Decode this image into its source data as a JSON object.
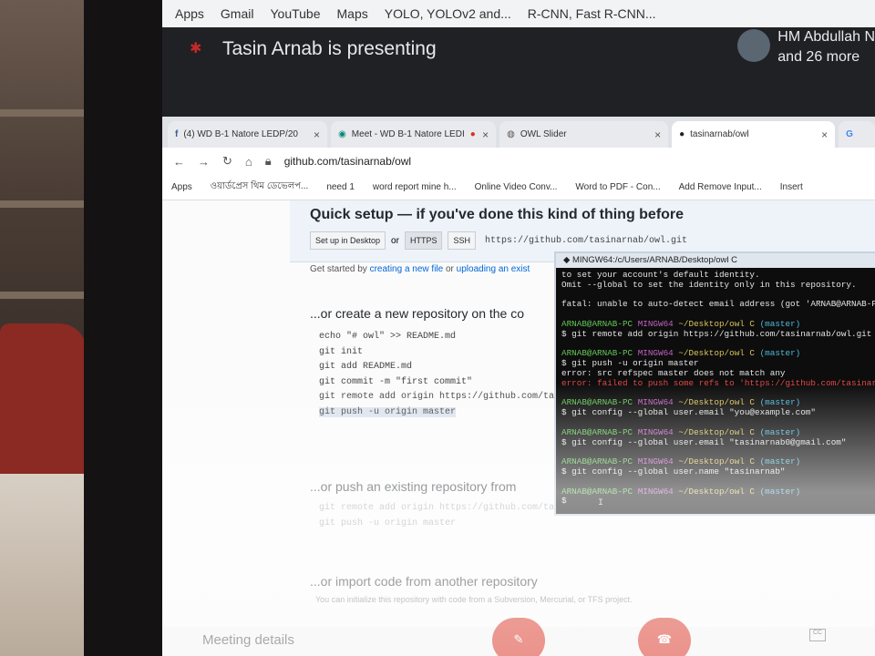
{
  "chrome_top": {
    "bookmarks": [
      "Apps",
      "Gmail",
      "YouTube",
      "Maps",
      "YOLO, YOLOv2 and...",
      "R-CNN, Fast R-CNN..."
    ]
  },
  "meet": {
    "presenter": "Tasin Arnab is presenting",
    "others_line1": "HM Abdullah N",
    "others_line2": "and 26 more",
    "meeting_details": "Meeting details"
  },
  "tabs": [
    {
      "label": "(4) WD B-1 Natore LEDP/20",
      "close": "×"
    },
    {
      "label": "Meet - WD B-1 Natore LEDI",
      "close": "×"
    },
    {
      "label": "OWL Slider",
      "close": "×"
    },
    {
      "label": "tasinarnab/owl",
      "close": "×"
    },
    {
      "label": "G"
    }
  ],
  "omnibox": {
    "url": "github.com/tasinarnab/owl"
  },
  "bookmarks": [
    "Apps",
    "ওয়ার্ডপ্রেস থিম ডেভেলপ...",
    "need 1",
    "word report mine h...",
    "Online Video Conv...",
    "Word to PDF - Con...",
    "Add Remove Input...",
    "Insert"
  ],
  "github": {
    "quick_title": "Quick setup — if you've done this kind of thing before",
    "setup_desktop": "Set up in Desktop",
    "or": "or",
    "https": "HTTPS",
    "ssh": "SSH",
    "clone_url": "https://github.com/tasinarnab/owl.git",
    "hint_start": "Get started by",
    "hint_link1": "creating a new file",
    "hint_mid": "or",
    "hint_link2": "uploading an exist",
    "section_create": "...or create a new repository on the co",
    "create_cmds": [
      "echo \"# owl\" >> README.md",
      "git init",
      "git add README.md",
      "git commit -m \"first commit\"",
      "git remote add origin https://github.com/ta",
      "git push -u origin master"
    ],
    "section_push": "...or push an existing repository from",
    "push_cmds": [
      "git remote add origin https://github.com/ta",
      "git push -u origin master"
    ],
    "section_import": "...or import code from another repository",
    "import_note": "You can initialize this repository with code from a Subversion, Mercurial, or TFS project."
  },
  "terminal": {
    "title": "MINGW64:/c/Users/ARNAB/Desktop/owl C",
    "lines": [
      [
        {
          "t": "to set your account's default identity.",
          "c": ""
        }
      ],
      [
        {
          "t": "Omit --global to set the identity only in this repository.",
          "c": ""
        }
      ],
      [
        {
          "t": " ",
          "c": ""
        }
      ],
      [
        {
          "t": "fatal: unable to auto-detect email address (got 'ARNAB@ARNAB-P",
          "c": ""
        }
      ],
      [
        {
          "t": " ",
          "c": ""
        }
      ],
      [
        {
          "t": "ARNAB@ARNAB-PC ",
          "c": "g"
        },
        {
          "t": "MINGW64 ",
          "c": "m"
        },
        {
          "t": "~/Desktop/owl C ",
          "c": "y"
        },
        {
          "t": "(master)",
          "c": "c"
        }
      ],
      [
        {
          "t": "$ git remote add origin https://github.com/tasinarnab/owl.git",
          "c": ""
        }
      ],
      [
        {
          "t": " ",
          "c": ""
        }
      ],
      [
        {
          "t": "ARNAB@ARNAB-PC ",
          "c": "g"
        },
        {
          "t": "MINGW64 ",
          "c": "m"
        },
        {
          "t": "~/Desktop/owl C ",
          "c": "y"
        },
        {
          "t": "(master)",
          "c": "c"
        }
      ],
      [
        {
          "t": "$ git push -u origin master",
          "c": ""
        }
      ],
      [
        {
          "t": "error: src refspec master does not match any",
          "c": ""
        }
      ],
      [
        {
          "t": "error: failed to push some refs to 'https://github.com/tasinarn",
          "c": "r"
        }
      ],
      [
        {
          "t": " ",
          "c": ""
        }
      ],
      [
        {
          "t": "ARNAB@ARNAB-PC ",
          "c": "g"
        },
        {
          "t": "MINGW64 ",
          "c": "m"
        },
        {
          "t": "~/Desktop/owl C ",
          "c": "y"
        },
        {
          "t": "(master)",
          "c": "c"
        }
      ],
      [
        {
          "t": "$ git config --global user.email \"you@example.com\"",
          "c": ""
        }
      ],
      [
        {
          "t": " ",
          "c": ""
        }
      ],
      [
        {
          "t": "ARNAB@ARNAB-PC ",
          "c": "g"
        },
        {
          "t": "MINGW64 ",
          "c": "m"
        },
        {
          "t": "~/Desktop/owl C ",
          "c": "y"
        },
        {
          "t": "(master)",
          "c": "c"
        }
      ],
      [
        {
          "t": "$ git config --global user.email \"tasinarnab0@gmail.com\"",
          "c": ""
        }
      ],
      [
        {
          "t": " ",
          "c": ""
        }
      ],
      [
        {
          "t": "ARNAB@ARNAB-PC ",
          "c": "g"
        },
        {
          "t": "MINGW64 ",
          "c": "m"
        },
        {
          "t": "~/Desktop/owl C ",
          "c": "y"
        },
        {
          "t": "(master)",
          "c": "c"
        }
      ],
      [
        {
          "t": "$ git config --global user.name \"tasinarnab\"",
          "c": ""
        }
      ],
      [
        {
          "t": " ",
          "c": ""
        }
      ],
      [
        {
          "t": "ARNAB@ARNAB-PC ",
          "c": "g"
        },
        {
          "t": "MINGW64 ",
          "c": "m"
        },
        {
          "t": "~/Desktop/owl C ",
          "c": "y"
        },
        {
          "t": "(master)",
          "c": "c"
        }
      ],
      [
        {
          "t": "$",
          "c": ""
        }
      ]
    ]
  },
  "icons": {
    "mic": "mic-off-icon",
    "end_call": "end-call-icon",
    "cc": "CC"
  }
}
